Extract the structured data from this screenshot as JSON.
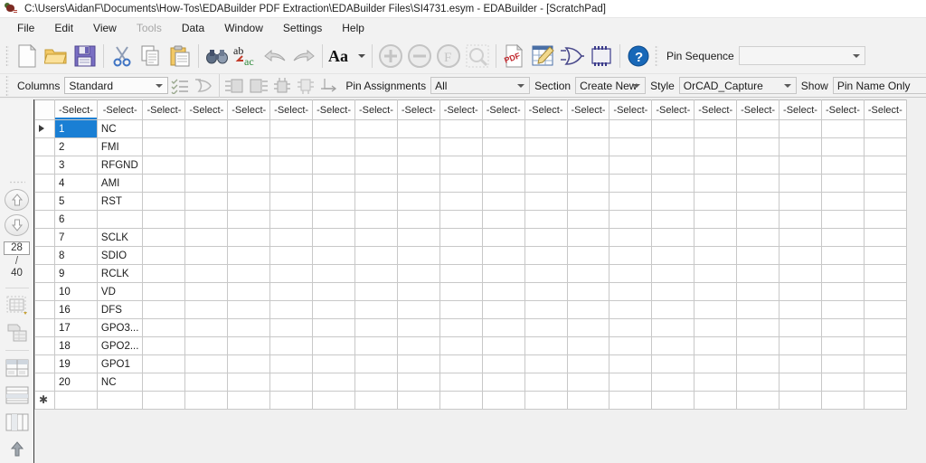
{
  "window": {
    "title": "C:\\Users\\AidanF\\Documents\\How-Tos\\EDABuilder PDF Extraction\\EDABuilder Files\\SI4731.esym - EDABuilder - [ScratchPad]",
    "icon": "app-bug-icon"
  },
  "menu": {
    "items": [
      {
        "label": "File",
        "disabled": false
      },
      {
        "label": "Edit",
        "disabled": false
      },
      {
        "label": "View",
        "disabled": false
      },
      {
        "label": "Tools",
        "disabled": true
      },
      {
        "label": "Data",
        "disabled": false
      },
      {
        "label": "Window",
        "disabled": false
      },
      {
        "label": "Settings",
        "disabled": false
      },
      {
        "label": "Help",
        "disabled": false
      }
    ]
  },
  "toolbar_main": {
    "icons": [
      "new-document-icon",
      "open-folder-icon",
      "save-floppy-icon",
      "cut-scissors-icon",
      "copy-icon",
      "paste-icon",
      "find-binoculars-icon",
      "replace-ab-ac-icon",
      "undo-arrow-icon",
      "redo-arrow-icon",
      "font-aa-icon",
      "zoom-in-icon",
      "zoom-out-icon",
      "zoom-fit-icon",
      "zoom-select-icon",
      "pdf-icon",
      "spreadsheet-edit-icon",
      "logic-gate-icon",
      "ic-chip-icon",
      "help-question-icon"
    ],
    "pin_sequence": {
      "label": "Pin Sequence",
      "value": "",
      "options": [
        "Pin Sequence"
      ]
    }
  },
  "toolbar_options": {
    "columns": {
      "label": "Columns",
      "value": "Standard",
      "options": [
        "Standard"
      ]
    },
    "icons": [
      "checklist-icon",
      "gate-pin-icon",
      "pins-left-icon",
      "pins-right-icon",
      "pins-top-icon",
      "pins-bottom-icon",
      "pin-split-icon"
    ],
    "pin_assignments": {
      "label": "Pin Assignments",
      "value": "All",
      "options": [
        "All"
      ]
    },
    "section": {
      "label": "Section",
      "value": "Create New",
      "options": [
        "Create New"
      ]
    },
    "style": {
      "label": "Style",
      "value": "OrCAD_Capture",
      "options": [
        "OrCAD_Capture"
      ]
    },
    "show": {
      "label": "Show",
      "value": "Pin Name Only",
      "options": [
        "Pin Name Only"
      ]
    }
  },
  "left_toolbar": {
    "nav_up": "arrow-up-icon",
    "nav_down": "arrow-down-icon",
    "page_current": "28",
    "page_separator": "/",
    "page_total": "40",
    "icons": [
      "select-table-icon",
      "extract-page-icon",
      "table-split-icon",
      "table-rows-icon",
      "table-columns-icon",
      "table-merge-icon"
    ]
  },
  "grid": {
    "column_header_label": "-Select-",
    "column_count": 20,
    "selected_column_index": 0,
    "rows": [
      {
        "marker": "current",
        "number": "1",
        "name": "NC",
        "selected": true
      },
      {
        "marker": "",
        "number": "2",
        "name": "FMI",
        "selected": false
      },
      {
        "marker": "",
        "number": "3",
        "name": "RFGND",
        "selected": false
      },
      {
        "marker": "",
        "number": "4",
        "name": "AMI",
        "selected": false
      },
      {
        "marker": "",
        "number": "5",
        "name": "RST",
        "selected": false
      },
      {
        "marker": "",
        "number": "6",
        "name": "",
        "selected": false
      },
      {
        "marker": "",
        "number": "7",
        "name": "SCLK",
        "selected": false
      },
      {
        "marker": "",
        "number": "8",
        "name": "SDIO",
        "selected": false
      },
      {
        "marker": "",
        "number": "9",
        "name": "RCLK",
        "selected": false
      },
      {
        "marker": "",
        "number": "10",
        "name": "VD",
        "selected": false
      },
      {
        "marker": "",
        "number": "16",
        "name": "DFS",
        "selected": false
      },
      {
        "marker": "",
        "number": "17",
        "name": "GPO3...",
        "selected": false
      },
      {
        "marker": "",
        "number": "18",
        "name": "GPO2...",
        "selected": false
      },
      {
        "marker": "",
        "number": "19",
        "name": "GPO1",
        "selected": false
      },
      {
        "marker": "",
        "number": "20",
        "name": "NC",
        "selected": false
      },
      {
        "marker": "new",
        "number": "",
        "name": "",
        "selected": false
      }
    ]
  },
  "colors": {
    "accent": "#1a7fd4",
    "chrome": "#f2f2f2",
    "grid_line": "#c8c8c8",
    "disabled_text": "#a7a7a7"
  }
}
